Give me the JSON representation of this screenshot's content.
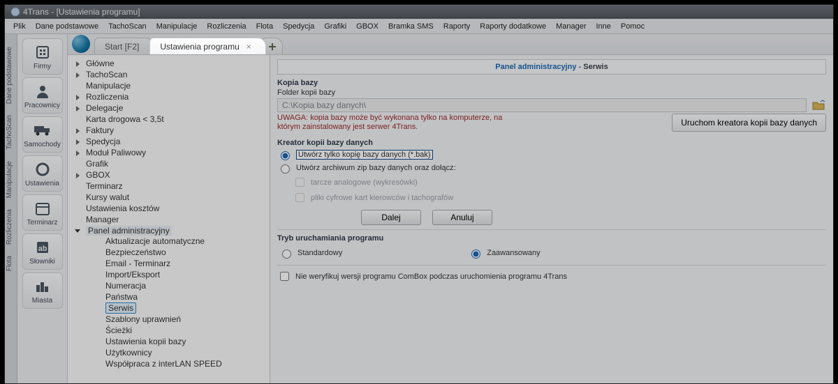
{
  "window": {
    "title": "4Trans - [Ustawienia programu]"
  },
  "menu": [
    "Plik",
    "Dane podstawowe",
    "TachoScan",
    "Manipulacje",
    "Rozliczenia",
    "Flota",
    "Spedycja",
    "Grafiki",
    "GBOX",
    "Bramka SMS",
    "Raporty",
    "Raporty dodatkowe",
    "Manager",
    "Inne",
    "Pomoc"
  ],
  "side_tabs": [
    "Dane podstawowe",
    "TachoScan",
    "Manipulacje",
    "Rozliczenia",
    "Flota"
  ],
  "rail": [
    {
      "key": "firmy",
      "label": "Firmy"
    },
    {
      "key": "pracownicy",
      "label": "Pracownicy"
    },
    {
      "key": "samochody",
      "label": "Samochody"
    },
    {
      "key": "ustawienia",
      "label": "Ustawienia"
    },
    {
      "key": "terminarz",
      "label": "Terminarz"
    },
    {
      "key": "slowniki",
      "label": "Słowniki"
    },
    {
      "key": "miasta",
      "label": "Miasta"
    }
  ],
  "doc_tabs": {
    "tab0": "Start [F2]",
    "tab1": "Ustawienia programu",
    "close": "×",
    "add": "+"
  },
  "tree": {
    "top": [
      "Główne",
      "TachoScan",
      "Manipulacje",
      "Rozliczenia",
      "Delegacje",
      "Karta drogowa < 3,5t",
      "Faktury",
      "Spedycja",
      "Moduł Paliwowy",
      "Grafik",
      "GBOX",
      "Terminarz",
      "Kursy walut",
      "Ustawienia kosztów",
      "Manager"
    ],
    "admin_label": "Panel administracyjny",
    "admin_children": [
      "Aktualizacje automatyczne",
      "Bezpieczeństwo",
      "Email - Terminarz",
      "Import/Eksport",
      "Numeracja",
      "Państwa",
      "Serwis",
      "Szablony uprawnień",
      "Ścieżki",
      "Ustawienia kopii bazy",
      "Użytkownicy",
      "Współpraca z interLAN SPEED"
    ]
  },
  "panel": {
    "header_left": "Panel administracyjny",
    "header_sep": " - ",
    "header_right": "Serwis",
    "section_backup": "Kopia bazy",
    "folder_label": "Folder kopii bazy",
    "folder_value": "C:\\Kopia bazy danych\\",
    "warning": "UWAGA: kopia bazy może być wykonana tylko na komputerze, na którym zainstalowany jest serwer 4Trans.",
    "wizard_btn": "Uruchom kreatora kopii bazy danych",
    "section_wizard": "Kreator kopii bazy danych",
    "radio_bak": "Utwórz tylko kopię bazy danych (*.bak)",
    "radio_zip": "Utwórz archiwum zip bazy danych oraz dołącz:",
    "chk_analog": "tarcze analogowe (wykresówki)",
    "chk_digital": "pliki cyfrowe kart kierowców i tachografów",
    "btn_next": "Dalej",
    "btn_cancel": "Anuluj",
    "section_mode": "Tryb uruchamiania programu",
    "radio_std": "Standardowy",
    "radio_adv": "Zaawansowany",
    "chk_verify": "Nie weryfikuj wersji programu ComBox podczas uruchomienia programu 4Trans"
  }
}
